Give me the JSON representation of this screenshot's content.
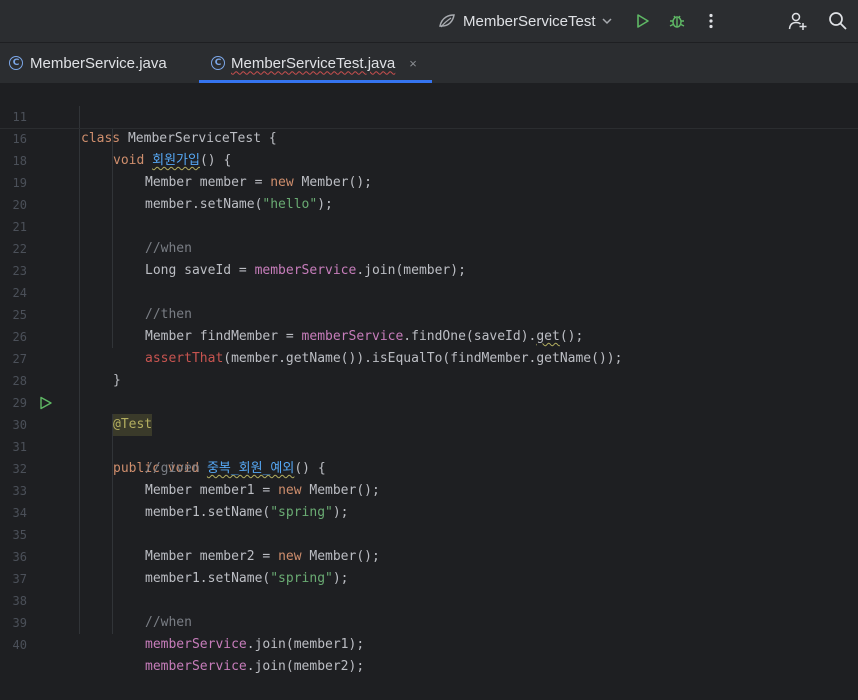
{
  "toolbar": {
    "run_config_name": "MemberServiceTest",
    "icons": [
      "spring-config-icon",
      "chevron-down-icon",
      "run-icon",
      "debug-icon",
      "more-icon",
      "add-user-icon",
      "search-icon"
    ]
  },
  "tabs": [
    {
      "label": "MemberService.java",
      "active": false
    },
    {
      "label": "MemberServiceTest.java",
      "active": true,
      "close": "×"
    }
  ],
  "editor": {
    "lines": [
      {
        "n": "11",
        "html": "class MemberServiceTest {",
        "indent": 2
      },
      {
        "n": "16",
        "indent": 4
      },
      {
        "n": "18",
        "indent": 8
      },
      {
        "n": "19",
        "indent": 8
      },
      {
        "n": "20",
        "indent": 0
      },
      {
        "n": "21",
        "indent": 8
      },
      {
        "n": "22",
        "indent": 8
      },
      {
        "n": "23",
        "indent": 0
      },
      {
        "n": "24",
        "indent": 8
      },
      {
        "n": "25",
        "indent": 8
      },
      {
        "n": "26",
        "indent": 8
      },
      {
        "n": "27",
        "indent": 4
      },
      {
        "n": "28",
        "indent": 0
      },
      {
        "n": "29",
        "indent": 4
      },
      {
        "n": "30",
        "indent": 4
      },
      {
        "n": "31",
        "indent": 8
      },
      {
        "n": "32",
        "indent": 8
      },
      {
        "n": "33",
        "indent": 8
      },
      {
        "n": "34",
        "indent": 0
      },
      {
        "n": "35",
        "indent": 8
      },
      {
        "n": "36",
        "indent": 8
      },
      {
        "n": "37",
        "indent": 0
      },
      {
        "n": "38",
        "indent": 8
      },
      {
        "n": "39",
        "indent": 8
      },
      {
        "n": "40",
        "indent": 8
      }
    ],
    "text": {
      "l11": [
        "class",
        " MemberServiceTest {"
      ],
      "l16": [
        "void",
        " ",
        "회원가입",
        "() {"
      ],
      "l18": [
        "Member member = ",
        "new",
        " Member();"
      ],
      "l19": [
        "member.setName(",
        "\"hello\"",
        ");"
      ],
      "l21": [
        "//when"
      ],
      "l22": [
        "Long saveId = ",
        "memberService",
        ".join(member);"
      ],
      "l24": [
        "//then"
      ],
      "l25": [
        "Member findMember = ",
        "memberService",
        ".findOne(saveId).",
        "get",
        "();"
      ],
      "l26": [
        "assertThat",
        "(member.getName()).isEqualTo(findMember.getName());"
      ],
      "l27": [
        "}"
      ],
      "l29": [
        "@Test"
      ],
      "l30": [
        "public",
        " ",
        "void",
        " ",
        "중복_회원_예외",
        "() {"
      ],
      "l31": [
        "//given"
      ],
      "l32": [
        "Member member1 = ",
        "new",
        " Member();"
      ],
      "l33": [
        "member1.setName(",
        "\"spring\"",
        ");"
      ],
      "l35": [
        "Member member2 = ",
        "new",
        " Member();"
      ],
      "l36": [
        "member1.setName(",
        "\"spring\"",
        ");"
      ],
      "l38": [
        "//when"
      ],
      "l39": [
        "memberService",
        ".join(member1);"
      ],
      "l40": [
        "memberService",
        ".join(member2);"
      ]
    }
  }
}
